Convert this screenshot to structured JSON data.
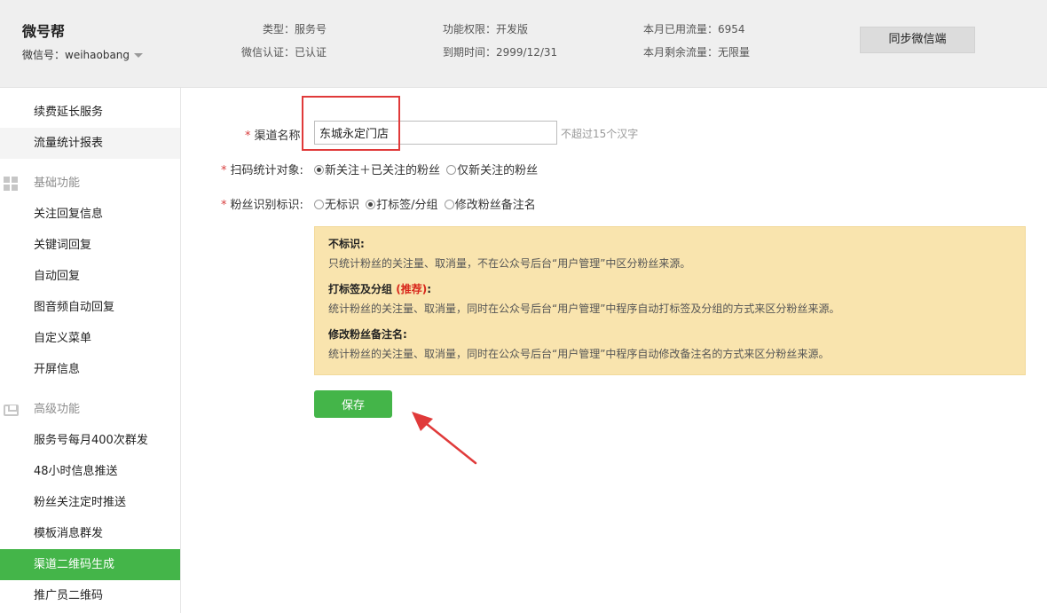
{
  "header": {
    "brand": "微号帮",
    "wechat_id": "微信号：weihaobang",
    "type": "类型：服务号",
    "verify": "微信认证：已认证",
    "permission": "功能权限：开发版",
    "expire": "到期时间：2999/12/31",
    "traffic_used": "本月已用流量：6954",
    "traffic_left": "本月剩余流量：无限量",
    "sync_button": "同步微信端"
  },
  "sidebar": {
    "top_items": [
      {
        "label": "续费延长服务"
      },
      {
        "label": "流量统计报表"
      }
    ],
    "basic_section": "基础功能",
    "basic_items": [
      {
        "label": "关注回复信息"
      },
      {
        "label": "关键词回复"
      },
      {
        "label": "自动回复"
      },
      {
        "label": "图音频自动回复"
      },
      {
        "label": "自定义菜单"
      },
      {
        "label": "开屏信息"
      }
    ],
    "advanced_section": "高级功能",
    "advanced_items": [
      {
        "label": "服务号每月400次群发"
      },
      {
        "label": "48小时信息推送"
      },
      {
        "label": "粉丝关注定时推送"
      },
      {
        "label": "模板消息群发"
      },
      {
        "label": "渠道二维码生成"
      },
      {
        "label": "推广员二维码"
      }
    ]
  },
  "form": {
    "required_mark": "*",
    "channel_name_label": "渠道名称:",
    "channel_name_value": "东城永定门店",
    "channel_name_hint": "不超过15个汉字",
    "scan_label": "扫码统计对象:",
    "scan_options": [
      "新关注＋已关注的粉丝",
      "仅新关注的粉丝"
    ],
    "fan_label": "粉丝识别标识:",
    "fan_options": [
      "无标识",
      "打标签/分组",
      "修改粉丝备注名"
    ]
  },
  "notice": {
    "t1": "不标识:",
    "d1": "只统计粉丝的关注量、取消量，不在公众号后台“用户管理”中区分粉丝来源。",
    "t2": "打标签及分组",
    "t2_rec": "(推荐)",
    "t2_colon": ":",
    "d2": "统计粉丝的关注量、取消量，同时在公众号后台“用户管理”中程序自动打标签及分组的方式来区分粉丝来源。",
    "t3": "修改粉丝备注名:",
    "d3": "统计粉丝的关注量、取消量，同时在公众号后台“用户管理”中程序自动修改备注名的方式来区分粉丝来源。"
  },
  "save_button": "保存",
  "colors": {
    "accent_green": "#44b549",
    "annotation_red": "#e03a3a",
    "notice_bg": "#f9e4ae"
  }
}
